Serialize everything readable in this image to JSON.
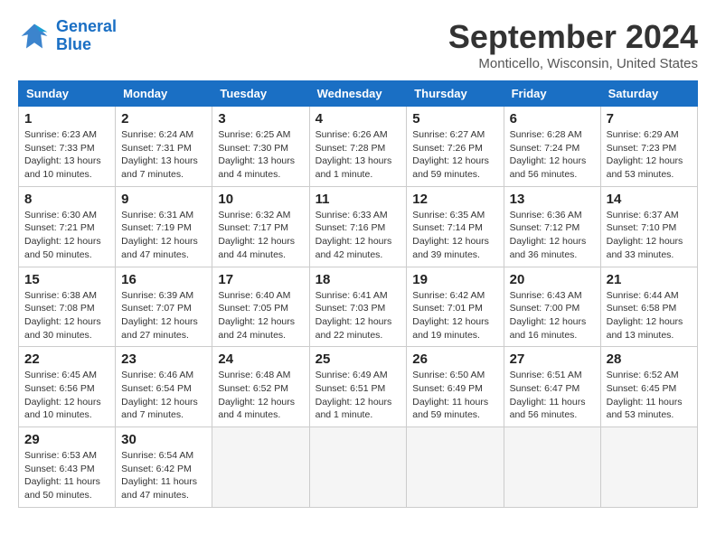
{
  "logo": {
    "text_general": "General",
    "text_blue": "Blue"
  },
  "title": "September 2024",
  "location": "Monticello, Wisconsin, United States",
  "days_of_week": [
    "Sunday",
    "Monday",
    "Tuesday",
    "Wednesday",
    "Thursday",
    "Friday",
    "Saturday"
  ],
  "weeks": [
    [
      {
        "day": "1",
        "info": "Sunrise: 6:23 AM\nSunset: 7:33 PM\nDaylight: 13 hours\nand 10 minutes."
      },
      {
        "day": "2",
        "info": "Sunrise: 6:24 AM\nSunset: 7:31 PM\nDaylight: 13 hours\nand 7 minutes."
      },
      {
        "day": "3",
        "info": "Sunrise: 6:25 AM\nSunset: 7:30 PM\nDaylight: 13 hours\nand 4 minutes."
      },
      {
        "day": "4",
        "info": "Sunrise: 6:26 AM\nSunset: 7:28 PM\nDaylight: 13 hours\nand 1 minute."
      },
      {
        "day": "5",
        "info": "Sunrise: 6:27 AM\nSunset: 7:26 PM\nDaylight: 12 hours\nand 59 minutes."
      },
      {
        "day": "6",
        "info": "Sunrise: 6:28 AM\nSunset: 7:24 PM\nDaylight: 12 hours\nand 56 minutes."
      },
      {
        "day": "7",
        "info": "Sunrise: 6:29 AM\nSunset: 7:23 PM\nDaylight: 12 hours\nand 53 minutes."
      }
    ],
    [
      {
        "day": "8",
        "info": "Sunrise: 6:30 AM\nSunset: 7:21 PM\nDaylight: 12 hours\nand 50 minutes."
      },
      {
        "day": "9",
        "info": "Sunrise: 6:31 AM\nSunset: 7:19 PM\nDaylight: 12 hours\nand 47 minutes."
      },
      {
        "day": "10",
        "info": "Sunrise: 6:32 AM\nSunset: 7:17 PM\nDaylight: 12 hours\nand 44 minutes."
      },
      {
        "day": "11",
        "info": "Sunrise: 6:33 AM\nSunset: 7:16 PM\nDaylight: 12 hours\nand 42 minutes."
      },
      {
        "day": "12",
        "info": "Sunrise: 6:35 AM\nSunset: 7:14 PM\nDaylight: 12 hours\nand 39 minutes."
      },
      {
        "day": "13",
        "info": "Sunrise: 6:36 AM\nSunset: 7:12 PM\nDaylight: 12 hours\nand 36 minutes."
      },
      {
        "day": "14",
        "info": "Sunrise: 6:37 AM\nSunset: 7:10 PM\nDaylight: 12 hours\nand 33 minutes."
      }
    ],
    [
      {
        "day": "15",
        "info": "Sunrise: 6:38 AM\nSunset: 7:08 PM\nDaylight: 12 hours\nand 30 minutes."
      },
      {
        "day": "16",
        "info": "Sunrise: 6:39 AM\nSunset: 7:07 PM\nDaylight: 12 hours\nand 27 minutes."
      },
      {
        "day": "17",
        "info": "Sunrise: 6:40 AM\nSunset: 7:05 PM\nDaylight: 12 hours\nand 24 minutes."
      },
      {
        "day": "18",
        "info": "Sunrise: 6:41 AM\nSunset: 7:03 PM\nDaylight: 12 hours\nand 22 minutes."
      },
      {
        "day": "19",
        "info": "Sunrise: 6:42 AM\nSunset: 7:01 PM\nDaylight: 12 hours\nand 19 minutes."
      },
      {
        "day": "20",
        "info": "Sunrise: 6:43 AM\nSunset: 7:00 PM\nDaylight: 12 hours\nand 16 minutes."
      },
      {
        "day": "21",
        "info": "Sunrise: 6:44 AM\nSunset: 6:58 PM\nDaylight: 12 hours\nand 13 minutes."
      }
    ],
    [
      {
        "day": "22",
        "info": "Sunrise: 6:45 AM\nSunset: 6:56 PM\nDaylight: 12 hours\nand 10 minutes."
      },
      {
        "day": "23",
        "info": "Sunrise: 6:46 AM\nSunset: 6:54 PM\nDaylight: 12 hours\nand 7 minutes."
      },
      {
        "day": "24",
        "info": "Sunrise: 6:48 AM\nSunset: 6:52 PM\nDaylight: 12 hours\nand 4 minutes."
      },
      {
        "day": "25",
        "info": "Sunrise: 6:49 AM\nSunset: 6:51 PM\nDaylight: 12 hours\nand 1 minute."
      },
      {
        "day": "26",
        "info": "Sunrise: 6:50 AM\nSunset: 6:49 PM\nDaylight: 11 hours\nand 59 minutes."
      },
      {
        "day": "27",
        "info": "Sunrise: 6:51 AM\nSunset: 6:47 PM\nDaylight: 11 hours\nand 56 minutes."
      },
      {
        "day": "28",
        "info": "Sunrise: 6:52 AM\nSunset: 6:45 PM\nDaylight: 11 hours\nand 53 minutes."
      }
    ],
    [
      {
        "day": "29",
        "info": "Sunrise: 6:53 AM\nSunset: 6:43 PM\nDaylight: 11 hours\nand 50 minutes."
      },
      {
        "day": "30",
        "info": "Sunrise: 6:54 AM\nSunset: 6:42 PM\nDaylight: 11 hours\nand 47 minutes."
      },
      {
        "day": "",
        "info": ""
      },
      {
        "day": "",
        "info": ""
      },
      {
        "day": "",
        "info": ""
      },
      {
        "day": "",
        "info": ""
      },
      {
        "day": "",
        "info": ""
      }
    ]
  ]
}
